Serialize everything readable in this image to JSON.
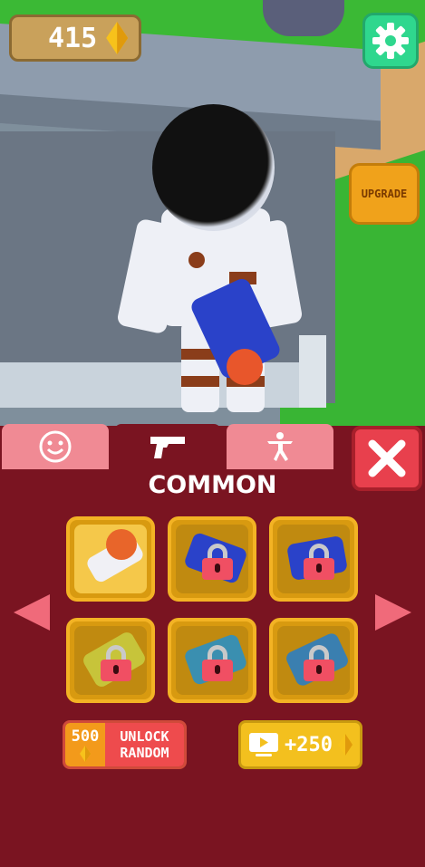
{
  "hud": {
    "currency_amount": "415",
    "currency_icon": "diamond-gem-icon",
    "settings_icon": "gear-icon",
    "upgrade_label": "UPGRADE"
  },
  "tabs": [
    {
      "icon": "smiley-face-icon",
      "active": false
    },
    {
      "icon": "pistol-icon",
      "active": true
    },
    {
      "icon": "pose-figure-icon",
      "active": false
    }
  ],
  "close_icon": "close-x-icon",
  "shop": {
    "section_title": "COMMON",
    "slots": [
      {
        "state": "selected",
        "weapon": "orange-blue-blaster"
      },
      {
        "state": "locked",
        "weapon": "blue-blaster"
      },
      {
        "state": "locked",
        "weapon": "blue-orange-blaster"
      },
      {
        "state": "locked",
        "weapon": "yellow-blaster"
      },
      {
        "state": "locked",
        "weapon": "teal-blue-blaster"
      },
      {
        "state": "locked",
        "weapon": "teal-orange-blaster"
      }
    ],
    "unlock_random": {
      "price": "500",
      "line1": "UNLOCK",
      "line2": "RANDOM"
    },
    "watch_ad": {
      "icon": "tv-play-icon",
      "amount": "+250"
    }
  },
  "colors": {
    "panel_bg": "#7a1421",
    "tab_inactive": "#f08a94",
    "slot_gold": "#d89a10",
    "lock_red": "#f04f63",
    "settings_green": "#2fd78e",
    "upgrade_orange": "#f0a21b"
  }
}
